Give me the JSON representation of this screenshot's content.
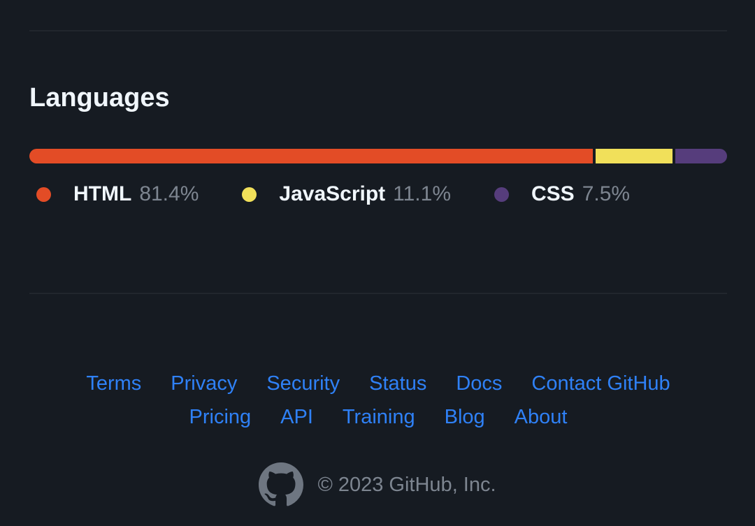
{
  "languages": {
    "title": "Languages",
    "items": [
      {
        "name": "HTML",
        "percent_label": "81.4%",
        "percent": 81.4,
        "color": "#e34c26"
      },
      {
        "name": "JavaScript",
        "percent_label": "11.1%",
        "percent": 11.1,
        "color": "#f1e05a"
      },
      {
        "name": "CSS",
        "percent_label": "7.5%",
        "percent": 7.5,
        "color": "#563d7c"
      }
    ]
  },
  "footer": {
    "links_row1": [
      "Terms",
      "Privacy",
      "Security",
      "Status",
      "Docs",
      "Contact GitHub"
    ],
    "links_row2": [
      "Pricing",
      "API",
      "Training",
      "Blog",
      "About"
    ],
    "copyright": "© 2023 GitHub, Inc.",
    "logo_icon": "github-mark-icon"
  },
  "colors": {
    "background": "#161b22",
    "link": "#2f81f7",
    "muted": "#7d8590",
    "divider": "#21262d"
  }
}
